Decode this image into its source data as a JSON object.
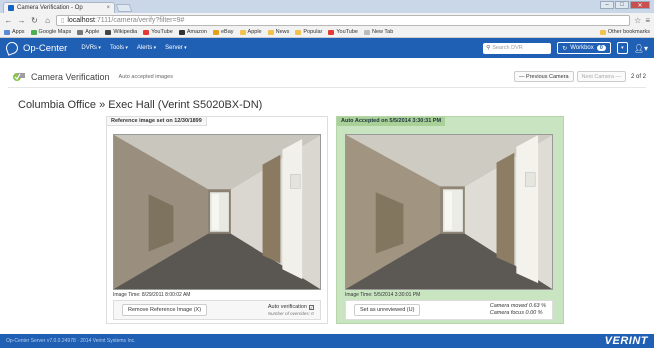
{
  "browser": {
    "tab_title": "Camera Verification - Op",
    "tab_close": "×",
    "url_host": "localhost",
    "url_rest": ":7111/camera/verify?filter=9#",
    "bookmarks": [
      {
        "label": "Apps",
        "color": "#5a8ad6"
      },
      {
        "label": "Google Maps",
        "color": "#4caf50"
      },
      {
        "label": "Apple",
        "color": "#777777"
      },
      {
        "label": "Wikipedia",
        "color": "#444444"
      },
      {
        "label": "YouTube",
        "color": "#e53935"
      },
      {
        "label": "Amazon",
        "color": "#333333"
      },
      {
        "label": "eBay",
        "color": "#e5a11b"
      },
      {
        "label": "Apple",
        "color": "#f2c14e"
      },
      {
        "label": "News",
        "color": "#f2c14e"
      },
      {
        "label": "Popular",
        "color": "#f2c14e"
      },
      {
        "label": "YouTube",
        "color": "#e53935"
      },
      {
        "label": "New Tab",
        "color": "#bbbbbb"
      }
    ],
    "other_bookmarks": "Other bookmarks"
  },
  "appnav": {
    "brand": "Op-Center",
    "menu": [
      "DVRs",
      "Tools",
      "Alerts",
      "Server"
    ],
    "search_placeholder": "Search DVR",
    "workbox_label": "Workbox",
    "workbox_count": "0",
    "accent": "#1f5fb4"
  },
  "subheader": {
    "title": "Camera Verification",
    "sublink": "Auto accepted images",
    "prev": "— Previous Camera",
    "next": "Next Camera —",
    "count": "2 of 2"
  },
  "page_title": "Columbia Office » Exec Hall (Verint S5020BX-DN)",
  "reference": {
    "header": "Reference image set on 12/30/1899",
    "image_time": "Image Time: 8/29/2011 8:00:02 AM",
    "button": "Remove Reference Image (X)",
    "auto_verification": "Auto verification",
    "overrides": "Number of overrides: 0"
  },
  "accepted": {
    "header": "Auto Accepted on 5/5/2014 3:30:31 PM",
    "image_time": "Image Time: 5/5/2014 3:30:01 PM",
    "button": "Set as unreviewed (U)",
    "camera_moved": "Camera moved 0.63 %",
    "camera_focus": "Camera focus 0.00 %",
    "highlight": "#c9e4c0"
  },
  "footer": {
    "copyright": "Op-Center Server v7.0.0.24978 · 2014 Verint Systems Inc.",
    "brand": "VERINT"
  }
}
